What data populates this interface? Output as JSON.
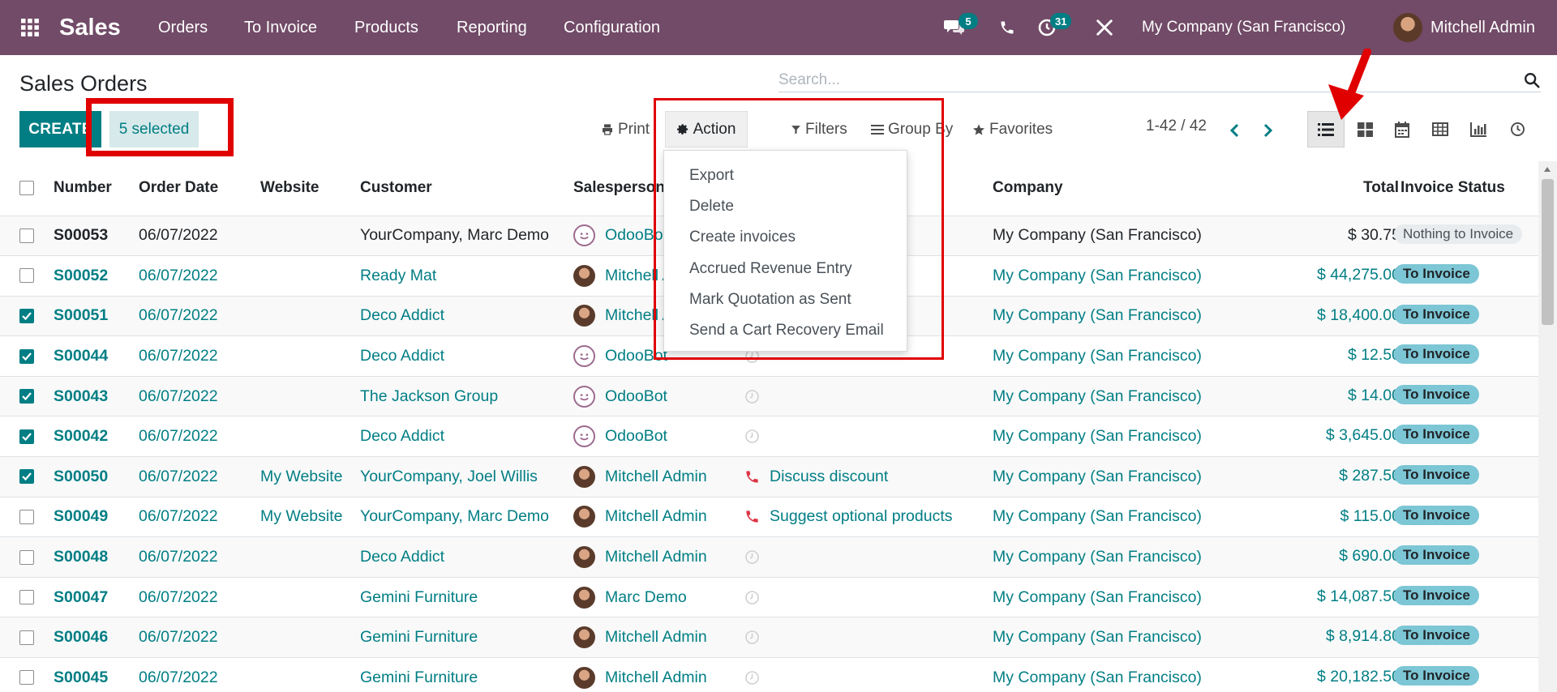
{
  "navbar": {
    "apps_icon": "grid-icon",
    "app_name": "Sales",
    "menus": [
      "Orders",
      "To Invoice",
      "Products",
      "Reporting",
      "Configuration"
    ],
    "messages_count": "5",
    "activities_count": "31",
    "company": "My Company (San Francisco)",
    "user": "Mitchell Admin",
    "accent": "#714B67"
  },
  "control_panel": {
    "title": "Sales Orders",
    "search_placeholder": "Search...",
    "create_label": "CREATE",
    "selected_label": "5 selected",
    "print_label": "Print",
    "action_label": "Action",
    "filters_label": "Filters",
    "groupby_label": "Group By",
    "favorites_label": "Favorites",
    "pager": "1-42 / 42",
    "views": [
      "list-icon",
      "kanban-icon",
      "calendar-icon",
      "pivot-icon",
      "graph-icon",
      "activity-icon"
    ],
    "active_view": "list"
  },
  "action_menu": {
    "items": [
      "Export",
      "Delete",
      "Create invoices",
      "Accrued Revenue Entry",
      "Mark Quotation as Sent",
      "Send a Cart Recovery Email"
    ]
  },
  "table": {
    "columns": [
      "Number",
      "Order Date",
      "Website",
      "Customer",
      "Salesperson",
      "Company",
      "Total",
      "Invoice Status"
    ],
    "rows": [
      {
        "checked": false,
        "number": "S00053",
        "date": "06/07/2022",
        "website": "",
        "customer": "YourCompany, Marc Demo",
        "salesperson": "OdooBot",
        "sp_avatar": "bot",
        "activity": "",
        "activity_icon": "",
        "company": "My Company (San Francisco)",
        "total": "$ 30.75",
        "status": "Nothing to Invoice",
        "status_style": "muted",
        "link": false
      },
      {
        "checked": false,
        "number": "S00052",
        "date": "06/07/2022",
        "website": "",
        "customer": "Ready Mat",
        "salesperson": "Mitchell Admin",
        "sp_avatar": "person",
        "activity": "",
        "activity_icon": "",
        "company": "My Company (San Francisco)",
        "total": "$ 44,275.00",
        "status": "To Invoice",
        "status_style": "info",
        "link": true
      },
      {
        "checked": true,
        "number": "S00051",
        "date": "06/07/2022",
        "website": "",
        "customer": "Deco Addict",
        "salesperson": "Mitchell Admin",
        "sp_avatar": "person",
        "activity": "",
        "activity_icon": "",
        "company": "My Company (San Francisco)",
        "total": "$ 18,400.00",
        "status": "To Invoice",
        "status_style": "info",
        "link": true
      },
      {
        "checked": true,
        "number": "S00044",
        "date": "06/07/2022",
        "website": "",
        "customer": "Deco Addict",
        "salesperson": "OdooBot",
        "sp_avatar": "bot",
        "activity": "",
        "activity_icon": "clock",
        "company": "My Company (San Francisco)",
        "total": "$ 12.50",
        "status": "To Invoice",
        "status_style": "info",
        "link": true
      },
      {
        "checked": true,
        "number": "S00043",
        "date": "06/07/2022",
        "website": "",
        "customer": "The Jackson Group",
        "salesperson": "OdooBot",
        "sp_avatar": "bot",
        "activity": "",
        "activity_icon": "clock",
        "company": "My Company (San Francisco)",
        "total": "$ 14.00",
        "status": "To Invoice",
        "status_style": "info",
        "link": true
      },
      {
        "checked": true,
        "number": "S00042",
        "date": "06/07/2022",
        "website": "",
        "customer": "Deco Addict",
        "salesperson": "OdooBot",
        "sp_avatar": "bot",
        "activity": "",
        "activity_icon": "clock",
        "company": "My Company (San Francisco)",
        "total": "$ 3,645.00",
        "status": "To Invoice",
        "status_style": "info",
        "link": true
      },
      {
        "checked": true,
        "number": "S00050",
        "date": "06/07/2022",
        "website": "My Website",
        "customer": "YourCompany, Joel Willis",
        "salesperson": "Mitchell Admin",
        "sp_avatar": "person",
        "activity": "Discuss discount",
        "activity_icon": "phone",
        "company": "My Company (San Francisco)",
        "total": "$ 287.50",
        "status": "To Invoice",
        "status_style": "info",
        "link": true
      },
      {
        "checked": false,
        "number": "S00049",
        "date": "06/07/2022",
        "website": "My Website",
        "customer": "YourCompany, Marc Demo",
        "salesperson": "Mitchell Admin",
        "sp_avatar": "person",
        "activity": "Suggest optional products",
        "activity_icon": "phone",
        "company": "My Company (San Francisco)",
        "total": "$ 115.00",
        "status": "To Invoice",
        "status_style": "info",
        "link": true
      },
      {
        "checked": false,
        "number": "S00048",
        "date": "06/07/2022",
        "website": "",
        "customer": "Deco Addict",
        "salesperson": "Mitchell Admin",
        "sp_avatar": "person",
        "activity": "",
        "activity_icon": "clock",
        "company": "My Company (San Francisco)",
        "total": "$ 690.00",
        "status": "To Invoice",
        "status_style": "info",
        "link": true
      },
      {
        "checked": false,
        "number": "S00047",
        "date": "06/07/2022",
        "website": "",
        "customer": "Gemini Furniture",
        "salesperson": "Marc Demo",
        "sp_avatar": "person",
        "activity": "",
        "activity_icon": "clock",
        "company": "My Company (San Francisco)",
        "total": "$ 14,087.50",
        "status": "To Invoice",
        "status_style": "info",
        "link": true
      },
      {
        "checked": false,
        "number": "S00046",
        "date": "06/07/2022",
        "website": "",
        "customer": "Gemini Furniture",
        "salesperson": "Mitchell Admin",
        "sp_avatar": "person",
        "activity": "",
        "activity_icon": "clock",
        "company": "My Company (San Francisco)",
        "total": "$ 8,914.80",
        "status": "To Invoice",
        "status_style": "info",
        "link": true
      },
      {
        "checked": false,
        "number": "S00045",
        "date": "06/07/2022",
        "website": "",
        "customer": "Gemini Furniture",
        "salesperson": "Mitchell Admin",
        "sp_avatar": "person",
        "activity": "",
        "activity_icon": "clock",
        "company": "My Company (San Francisco)",
        "total": "$ 20,182.50",
        "status": "To Invoice",
        "status_style": "info",
        "link": true
      }
    ]
  },
  "annotation_color": "#e00000"
}
